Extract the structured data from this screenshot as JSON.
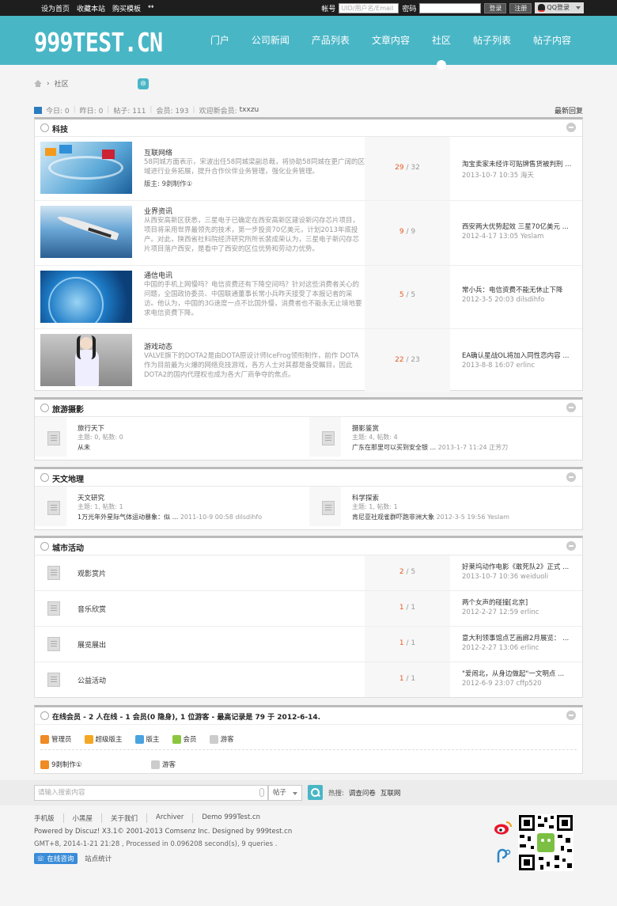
{
  "topbar": {
    "links": [
      "设为首页",
      "收藏本站",
      "购买模板"
    ],
    "arrow": "↔",
    "account_label": "帐号",
    "account_placeholder": "UID/用户名/Email",
    "password_label": "密码",
    "login": "登录",
    "register": "注册",
    "qq_login": "QQ登录"
  },
  "header": {
    "logo": "999TEST.CN",
    "nav": [
      "门户",
      "公司新闻",
      "产品列表",
      "文章内容",
      "社区",
      "帖子列表",
      "帖子内容"
    ],
    "active": "社区"
  },
  "breadcrumb": {
    "sep": "›",
    "current": "社区"
  },
  "stats": {
    "today": "今日: 0",
    "yesterday": "昨日: 0",
    "posts": "帖子: 111",
    "members": "会员: 193",
    "welcome": "欢迎新会员:",
    "new_user": "txxzu",
    "latest": "最新回复"
  },
  "colors": {
    "header": "#49b6c6",
    "count_accent": "#e85b20",
    "topbar": "#1e1e1e"
  },
  "sections": {
    "tech": {
      "title": "科技",
      "forums": [
        {
          "name": "互联网络",
          "desc": "58同城方面表示，宋波出任58同城梁副总裁，将协助58同城在更广阔的区域进行业务拓展，提升合作伙伴业务管理，强化业务管理。",
          "mod": "版主: 9剥制作①",
          "topics": "29",
          "posts": "32",
          "last_title": "淘宝卖家未经许可贴牌售货被判刑 ...",
          "last_meta": "2013-10-7 10:35 海天"
        },
        {
          "name": "业界资讯",
          "desc": "从西安高新区获悉，三星电子已确定在西安高新区建设新闪存芯片项目，项目将采用世界最领先的技术，第一步投资70亿美元，计划2013年底投产。对此，陕西省社科院经济研究所所长裴成荣认为，三星电子新闪存芯片项目落户西安，是看中了西安的区位优势和劳动力优势。",
          "mod": "",
          "topics": "9",
          "posts": "9",
          "last_title": "西安两大优势起效 三星70亿美元 ...",
          "last_meta": "2012-4-17 13:05 Yeslam"
        },
        {
          "name": "通信电讯",
          "desc": "中国的手机上网慢吗？电信资费还有下降空间吗？针对这些消费者关心的问题，全国政协委员、中国联通董事长常小兵昨天接受了本报记者的采访。他认为，中国的3G速度一点不比国外慢，消费者也不能永无止境地要求电信资费下降。",
          "mod": "",
          "topics": "5",
          "posts": "5",
          "last_title": "常小兵：电信资费不能无休止下降",
          "last_meta": "2012-3-5 20:03 dilsdihfo"
        },
        {
          "name": "游戏动态",
          "desc": "VALVE旗下的DOTA2是由DOTA原设计师IceFrog领衔制作，前作 DOTA作为目前最为火爆的网络竞技游戏，各方人士对其都是备受瞩目，因此DOTA2的国内代理权也成为各大厂商争夺的焦点。",
          "mod": "",
          "topics": "22",
          "posts": "23",
          "last_title": "EA确认星战OL将加入同性恋内容 ...",
          "last_meta": "2013-8-8 16:07 erlinc"
        }
      ]
    },
    "travel": {
      "title": "旅游摄影",
      "forums": [
        {
          "name": "旅行天下",
          "stat": "主题: 0, 帖数: 0",
          "last_title": "从未",
          "last_meta": ""
        },
        {
          "name": "摄影鉴赏",
          "stat": "主题: 4, 帖数: 4",
          "last_title": "广东在那里可以买到安全银 ...",
          "last_meta": "2013-1-7 11:24 正芳刀"
        }
      ]
    },
    "astro": {
      "title": "天文地理",
      "forums": [
        {
          "name": "天文研究",
          "stat": "主题: 1, 帖数: 1",
          "last_title": "1万光年外星际气体运动暴象：似 ...",
          "last_meta": "2011-10-9 00:58 dilsdihfo"
        },
        {
          "name": "科学探索",
          "stat": "主题: 1, 帖数: 1",
          "last_title": "肯尼亚社观雀群吓跑非洲大象",
          "last_meta": "2012-3-5 19:56 YesIam"
        }
      ]
    },
    "city": {
      "title": "城市活动",
      "forums": [
        {
          "name": "观影赏片",
          "topics": "2",
          "posts": "5",
          "last_title": "好莱坞动作电影《敢死队2》正式 ...",
          "last_meta": "2013-10-7 10:36 weiduoli"
        },
        {
          "name": "音乐欣赏",
          "topics": "1",
          "posts": "1",
          "last_title": "两个女声的碰撞[北京]",
          "last_meta": "2012-2-27 12:59 erlinc"
        },
        {
          "name": "展览展出",
          "topics": "1",
          "posts": "1",
          "last_title": "意大利领事馆点艺画廊2月展览： ...",
          "last_meta": "2012-2-27 13:06 erlinc"
        },
        {
          "name": "公益活动",
          "topics": "1",
          "posts": "1",
          "last_title": "\"爱闹北，从身边做起\"一文明点 ...",
          "last_meta": "2012-6-9 23:07 cffp520"
        }
      ]
    }
  },
  "online": {
    "title": "在线会员 - 2 人在线 - 1 会员(0 隐身), 1 位游客 - 最高记录是 79 于 2012-6-14.",
    "legend": [
      "管理员",
      "超级版主",
      "版主",
      "会员",
      "游客"
    ],
    "users": [
      "9剥制作①",
      "游客"
    ]
  },
  "search": {
    "placeholder": "请输入搜索内容",
    "type": "帖子",
    "hot_label": "热搜:",
    "hot": [
      "调查问卷",
      "互联网"
    ]
  },
  "footer": {
    "links": [
      "手机版",
      "小黑屋",
      "关于我们",
      "Archiver",
      "Demo 999Test.cn"
    ],
    "powered": "Powered by Discuz! X3.1© 2001-2013 Comsenz Inc. Designed by 999test.cn",
    "timing": "GMT+8, 2014-1-21 21:28 , Processed in 0.096208 second(s), 9 queries .",
    "consult": "在线咨询",
    "stats": "站点统计"
  }
}
